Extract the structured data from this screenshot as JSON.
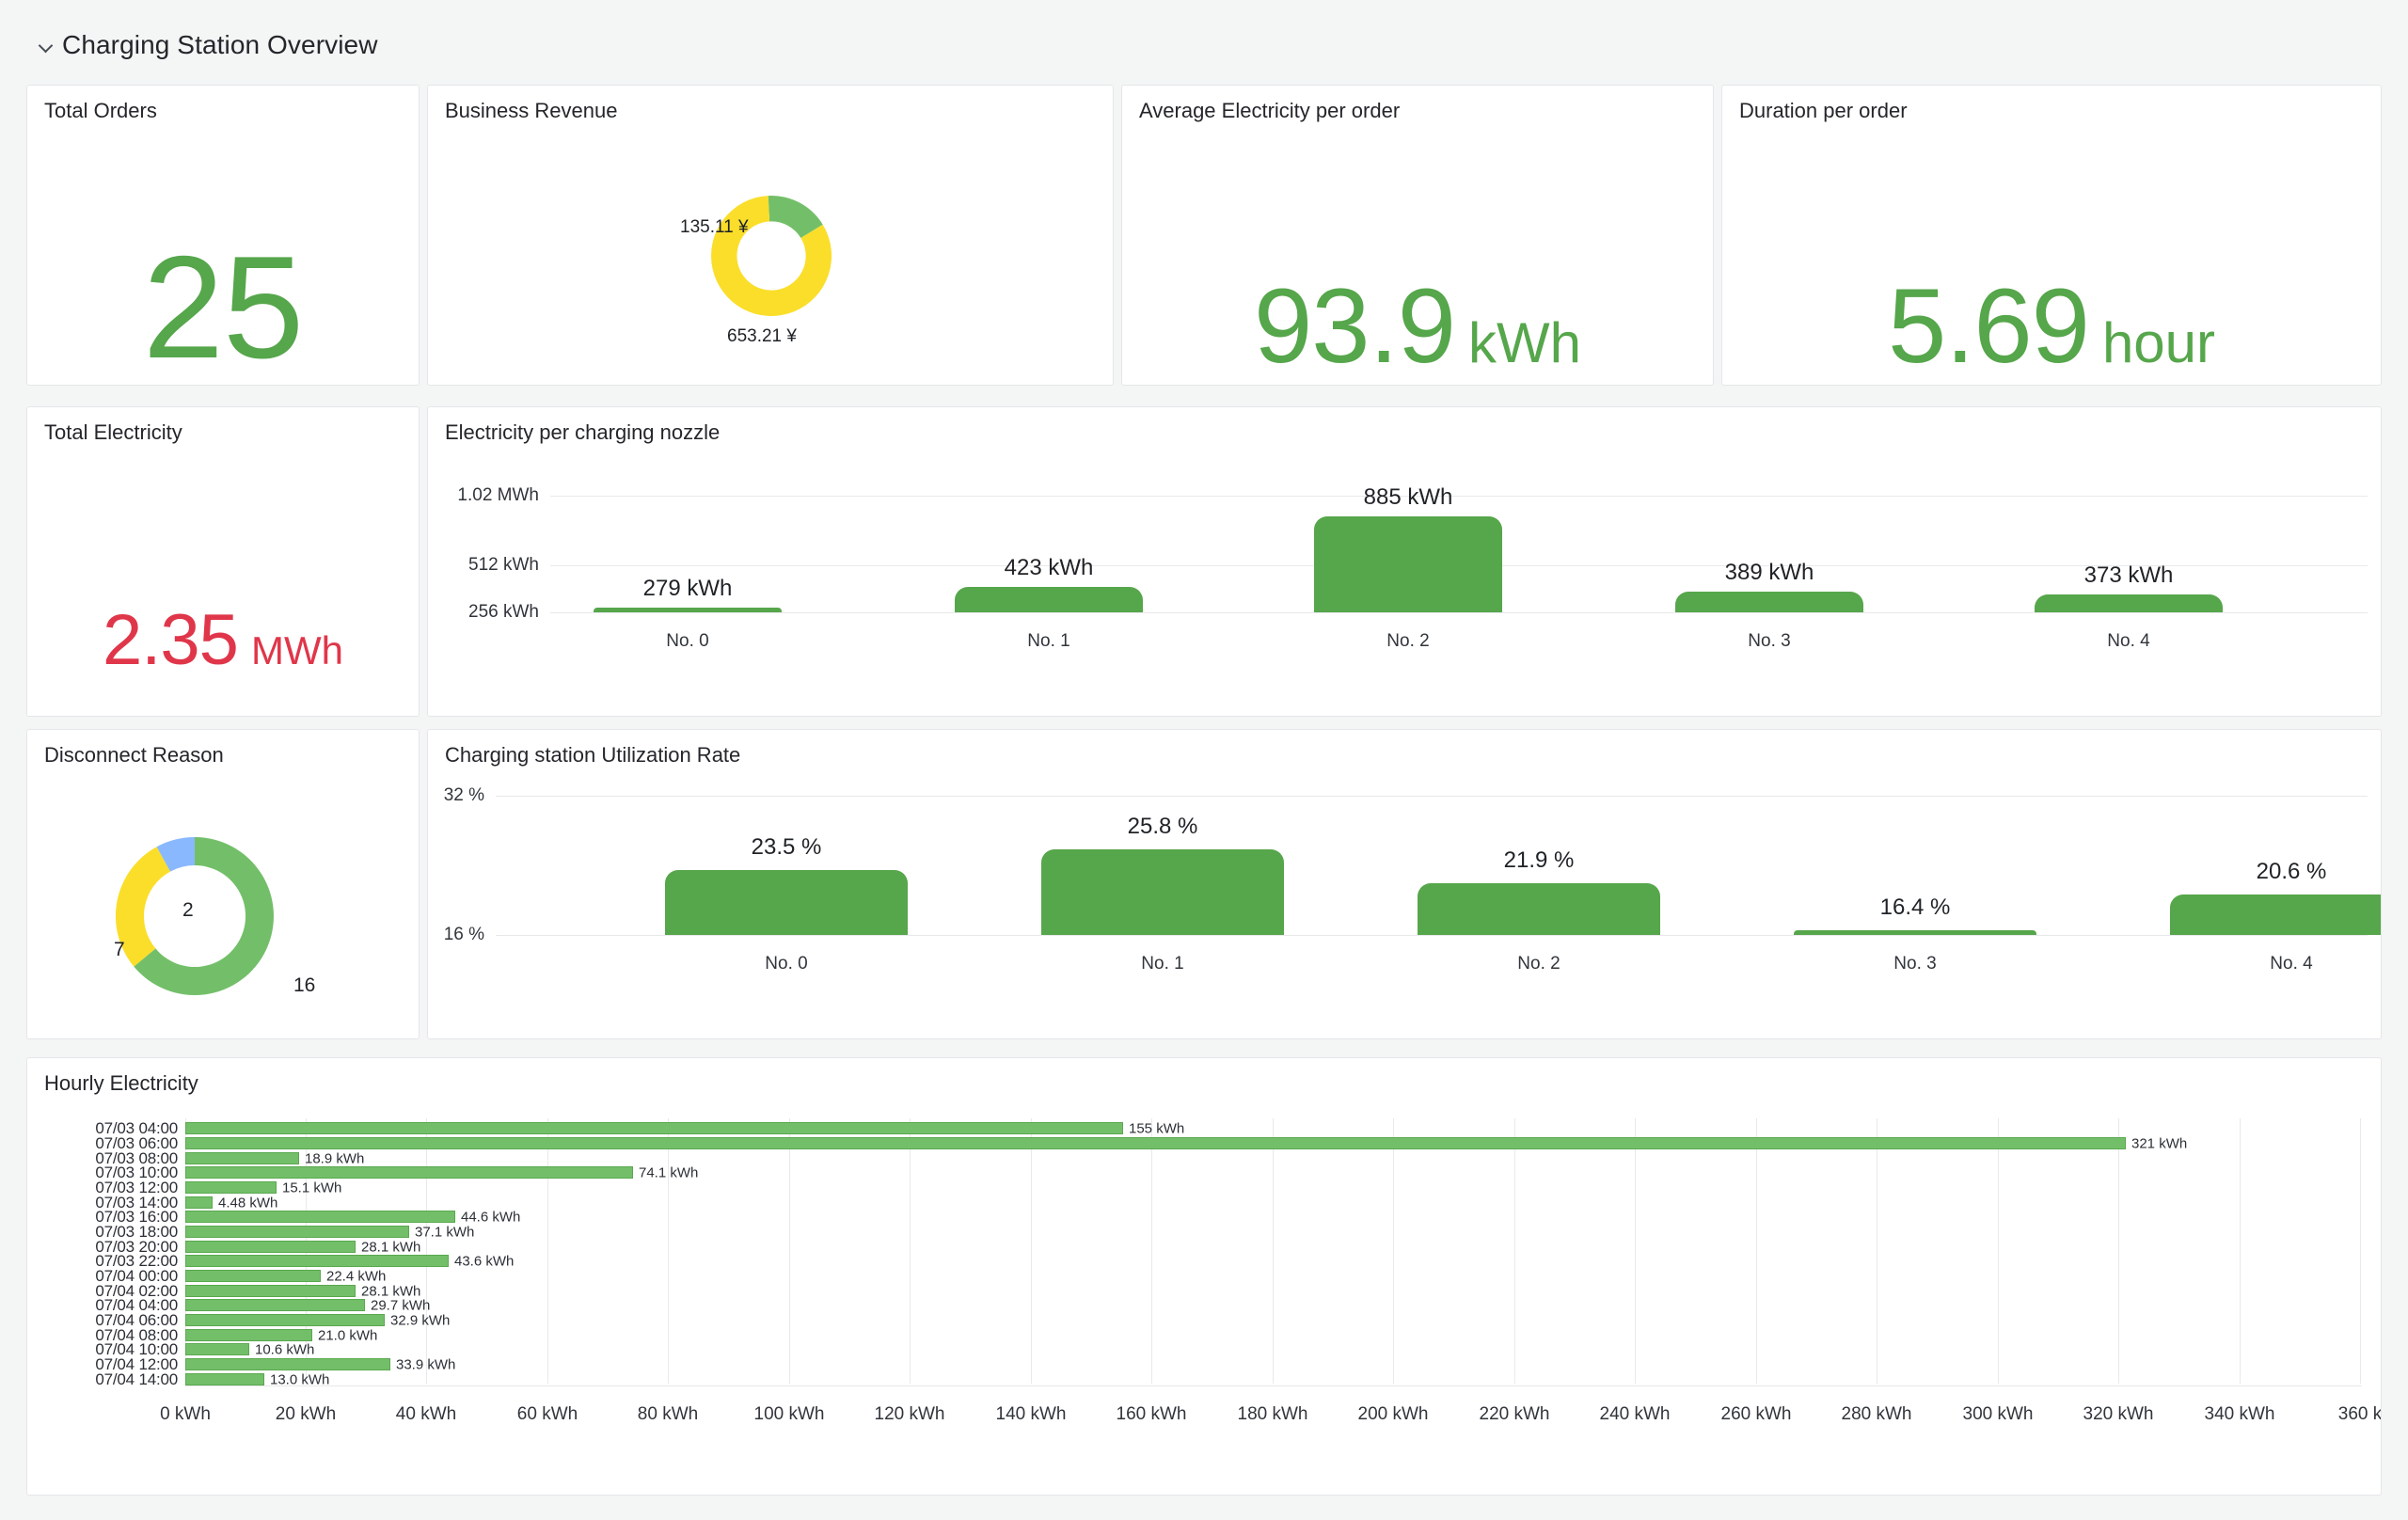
{
  "row": {
    "title": "Charging Station Overview",
    "chevron_icon": "chevron-down-icon"
  },
  "panels": {
    "total_orders": {
      "title": "Total Orders",
      "value": "25",
      "unit": "",
      "color": "#56a64b"
    },
    "business_revenue": {
      "title": "Business Revenue",
      "labels": [
        "135.11 ¥",
        "653.21 ¥"
      ]
    },
    "avg_electricity": {
      "title": "Average Electricity per order",
      "value": "93.9",
      "unit": "kWh",
      "color": "#56a64b"
    },
    "duration_per_order": {
      "title": "Duration per order",
      "value": "5.69",
      "unit": "hour",
      "color": "#56a64b"
    },
    "total_electricity": {
      "title": "Total Electricity",
      "value": "2.35",
      "unit": "MWh",
      "color": "#e0364a"
    },
    "electricity_per_nozzle": {
      "title": "Electricity per charging nozzle"
    },
    "disconnect_reason": {
      "title": "Disconnect Reason",
      "labels": [
        "2",
        "7",
        "16"
      ]
    },
    "utilization_rate": {
      "title": "Charging station Utilization Rate"
    },
    "hourly_electricity": {
      "title": "Hourly Electricity"
    }
  },
  "chart_data": [
    {
      "id": "business_revenue_pie",
      "type": "pie",
      "title": "Business Revenue",
      "labels": [
        "135.11 ¥",
        "653.21 ¥"
      ],
      "values": [
        135.11,
        653.21
      ],
      "colors": [
        "#73bf69",
        "#fade2a"
      ],
      "legend": "none",
      "donut": true
    },
    {
      "id": "electricity_per_nozzle_bars",
      "type": "bar",
      "title": "Electricity per charging nozzle",
      "categories": [
        "No. 0",
        "No. 1",
        "No. 2",
        "No. 3",
        "No. 4"
      ],
      "values": [
        279,
        423,
        885,
        389,
        373
      ],
      "value_labels": [
        "279 kWh",
        "423 kWh",
        "885 kWh",
        "389 kWh",
        "373 kWh"
      ],
      "ytick_labels": [
        "1.02 MWh",
        "512 kWh",
        "256 kWh"
      ],
      "ytick_values": [
        1020,
        512,
        256
      ],
      "ylim": [
        256,
        1020
      ],
      "ylabel": "",
      "xlabel": "",
      "grid": true,
      "color": "#56a64b"
    },
    {
      "id": "disconnect_reason_pie",
      "type": "pie",
      "title": "Disconnect Reason",
      "labels": [
        "2",
        "7",
        "16"
      ],
      "values": [
        2,
        7,
        16
      ],
      "colors": [
        "#8ab8ff",
        "#fade2a",
        "#73bf69"
      ],
      "legend": "none",
      "donut": true
    },
    {
      "id": "utilization_rate_bars",
      "type": "bar",
      "title": "Charging station Utilization Rate",
      "categories": [
        "No. 0",
        "No. 1",
        "No. 2",
        "No. 3",
        "No. 4"
      ],
      "values": [
        23.5,
        25.8,
        21.9,
        16.4,
        20.6
      ],
      "value_labels": [
        "23.5 %",
        "25.8 %",
        "21.9 %",
        "16.4 %",
        "20.6 %"
      ],
      "ytick_labels": [
        "32 %",
        "16 %"
      ],
      "ytick_values": [
        32,
        16
      ],
      "ylim": [
        16,
        32
      ],
      "ylabel": "",
      "xlabel": "",
      "grid": true,
      "color": "#56a64b"
    },
    {
      "id": "hourly_electricity_bars",
      "type": "bar",
      "orientation": "horizontal",
      "title": "Hourly Electricity",
      "categories": [
        "07/03 04:00",
        "07/03 06:00",
        "07/03 08:00",
        "07/03 10:00",
        "07/03 12:00",
        "07/03 14:00",
        "07/03 16:00",
        "07/03 18:00",
        "07/03 20:00",
        "07/03 22:00",
        "07/04 00:00",
        "07/04 02:00",
        "07/04 04:00",
        "07/04 06:00",
        "07/04 08:00",
        "07/04 10:00",
        "07/04 12:00",
        "07/04 14:00"
      ],
      "values": [
        155,
        321,
        18.9,
        74.1,
        15.1,
        4.48,
        44.6,
        37.1,
        28.1,
        43.6,
        22.4,
        28.1,
        29.7,
        32.9,
        21.0,
        10.6,
        33.9,
        13.0
      ],
      "value_labels": [
        "155 kWh",
        "321 kWh",
        "18.9 kWh",
        "74.1 kWh",
        "15.1 kWh",
        "4.48 kWh",
        "44.6 kWh",
        "37.1 kWh",
        "28.1 kWh",
        "43.6 kWh",
        "22.4 kWh",
        "28.1 kWh",
        "29.7 kWh",
        "32.9 kWh",
        "21.0 kWh",
        "10.6 kWh",
        "33.9 kWh",
        "13.0 kWh"
      ],
      "xtick_labels": [
        "0 kWh",
        "20 kWh",
        "40 kWh",
        "60 kWh",
        "80 kWh",
        "100 kWh",
        "120 kWh",
        "140 kWh",
        "160 kWh",
        "180 kWh",
        "200 kWh",
        "220 kWh",
        "240 kWh",
        "260 kWh",
        "280 kWh",
        "300 kWh",
        "320 kWh",
        "340 kWh",
        "360 k"
      ],
      "xtick_values": [
        0,
        20,
        40,
        60,
        80,
        100,
        120,
        140,
        160,
        180,
        200,
        220,
        240,
        260,
        280,
        300,
        320,
        340,
        360
      ],
      "xlim": [
        0,
        360
      ],
      "xlabel": "",
      "ylabel": "",
      "grid": true,
      "color": "#73bf69"
    }
  ]
}
